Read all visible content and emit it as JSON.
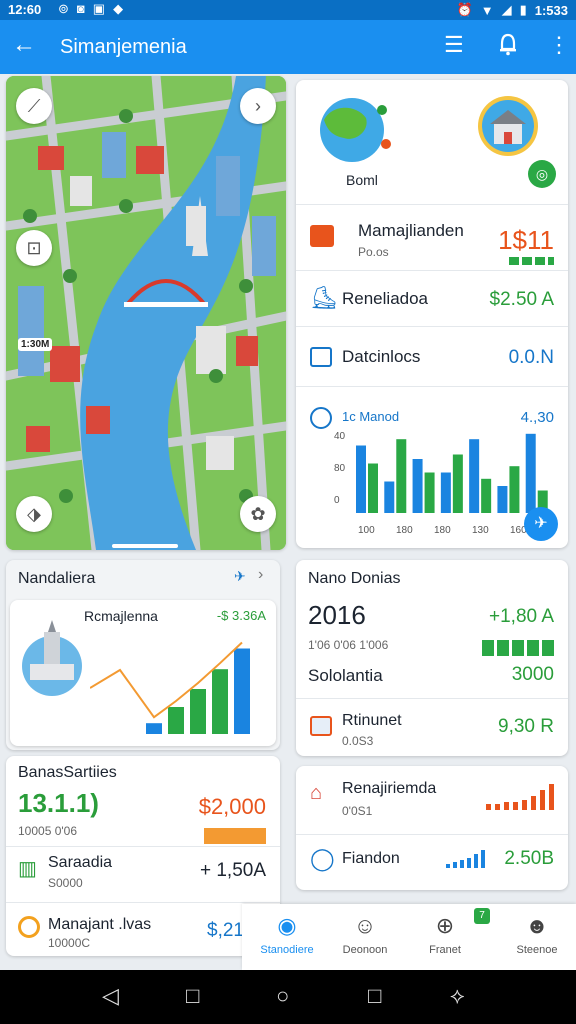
{
  "status_bar": {
    "time": "12:60",
    "battery_text": "1:533"
  },
  "app_bar": {
    "title": "Simanjemenia"
  },
  "map": {
    "chip_label": "1:30M"
  },
  "right_card": {
    "header_label": "Boml",
    "rows": [
      {
        "title": "Mamajlianden",
        "sub": "Po.os",
        "value": "1$11"
      },
      {
        "title": "Reneliadoa",
        "value": "$2.50 A"
      },
      {
        "title": "Datcinlocs",
        "value": "0.0.N"
      }
    ],
    "chart": {
      "label": "1c Manod",
      "corner_value": "4.,30",
      "y_ticks": [
        "40",
        "80",
        "0"
      ],
      "x_ticks": [
        "100",
        "180",
        "180",
        "130",
        "160"
      ]
    }
  },
  "chart_data": {
    "type": "bar",
    "title": "1c Manod",
    "yticks": [
      "40",
      "80",
      "0"
    ],
    "xticks": [
      "100",
      "180",
      "180",
      "130",
      "160"
    ],
    "series": [
      {
        "color": "#1a84e0",
        "values": [
          0.75,
          0.35,
          0.6,
          0.45,
          0.82,
          0.3,
          0.88
        ]
      },
      {
        "color": "#2aa845",
        "values": [
          0.55,
          0.82,
          0.45,
          0.65,
          0.38,
          0.52,
          0.25
        ]
      }
    ]
  },
  "left_panel": {
    "title": "Nandaliera",
    "inner_card": {
      "title": "Rcmajlenna",
      "value": "-$ 3.36A"
    },
    "chart_bars": [
      0.12,
      0.3,
      0.5,
      0.72,
      0.95
    ]
  },
  "left_bottom": {
    "title": "BanasSartiies",
    "big_value": "13.1.1)",
    "sub": "10005 0'06",
    "amount": "$2,000",
    "row2": {
      "title": "Saraadia",
      "sub": "S0000",
      "value": "+ 1,50A"
    },
    "row3": {
      "title": "Manajant .lvas",
      "sub": "10000C",
      "value": "$,21"
    }
  },
  "right_panel": {
    "title": "Nano Donias",
    "year": "2016",
    "sub": "1'06 0'06 1'006",
    "value": "+1,80 A",
    "row1": {
      "title": "Sololantia",
      "value": "3000"
    },
    "row2": {
      "title": "Rtinunet",
      "sub": "0.0S3",
      "value": "9,30 R"
    }
  },
  "right_bottom": {
    "row1": {
      "title": "Renajiriemda",
      "sub": "0'0S1"
    },
    "row2": {
      "title": "Fiandon",
      "value": "2.50B"
    }
  },
  "bottom_nav": {
    "items": [
      {
        "label": "Stanodiere"
      },
      {
        "label": "Deonoon"
      },
      {
        "label": "Franet"
      },
      {
        "label": "Steenoe"
      }
    ]
  },
  "colors": {
    "app_bar": "#1a8ff0",
    "status_bar": "#0a6fc4",
    "accent_green": "#2a9d3a",
    "accent_orange": "#e8541c",
    "accent_blue": "#1676c9"
  }
}
